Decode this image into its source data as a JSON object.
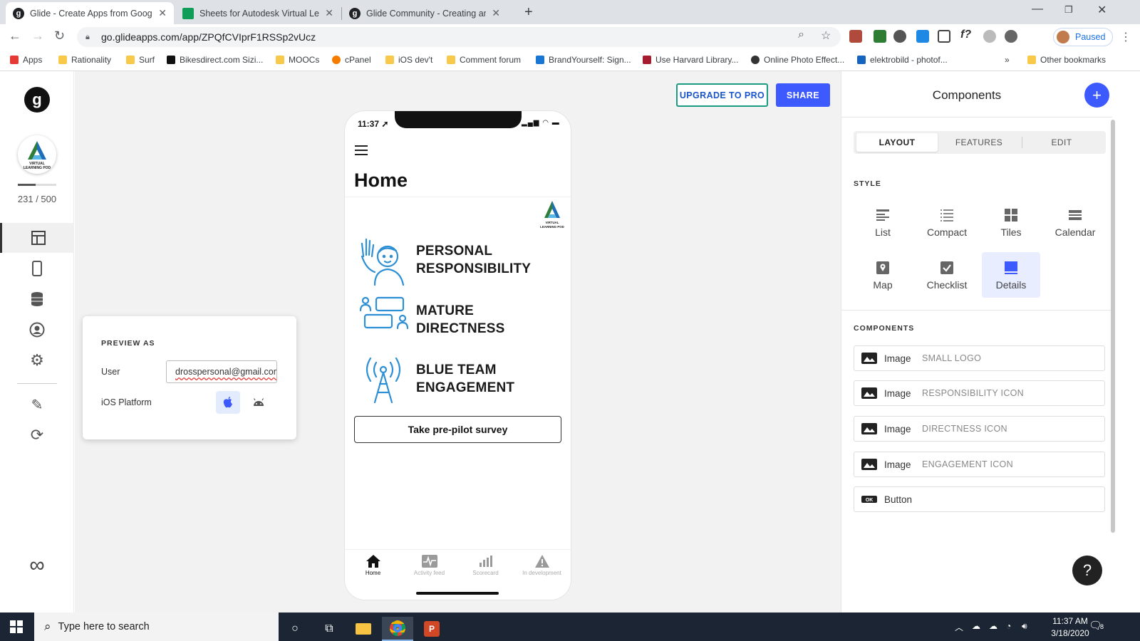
{
  "browser": {
    "tabs": [
      {
        "title": "Glide - Create Apps from Google",
        "favicon": "g"
      },
      {
        "title": "Sheets for Autodesk Virtual Learn",
        "favicon": "sheets"
      },
      {
        "title": "Glide Community - Creating ama",
        "favicon": "g"
      }
    ],
    "url": "go.glideapps.com/app/ZPQfCVIprF1RSSp2vUcz",
    "profile_status": "Paused",
    "bookmarks": [
      "Apps",
      "Rationality",
      "Surf",
      "Bikesdirect.com Sizi...",
      "MOOCs",
      "cPanel",
      "iOS dev't",
      "Comment forum",
      "BrandYourself: Sign...",
      "Use Harvard Library...",
      "Online Photo Effect...",
      "elektrobild - photof..."
    ],
    "bookmarks_overflow": "»",
    "other_bookmarks": "Other bookmarks"
  },
  "rail": {
    "logo_letter": "g",
    "app_icon_text": "VIRTUAL LEARNING POD",
    "rows_used": 231,
    "rows_max": 500,
    "rows_label": "231 / 500"
  },
  "header": {
    "upgrade_label": "UPGRADE TO PRO",
    "share_label": "SHARE"
  },
  "preview": {
    "heading": "PREVIEW AS",
    "user_label": "User",
    "user_value": "drosspersonal@gmail.com",
    "platform_label": "iOS Platform",
    "platform_selected": "ios"
  },
  "phone": {
    "time": "11:37",
    "title": "Home",
    "logo_text": "VIRTUAL LEARNING POD",
    "features": [
      {
        "line1": "PERSONAL",
        "line2": "RESPONSIBILITY",
        "icon": "waving-person-icon"
      },
      {
        "line1": "MATURE",
        "line2": "DIRECTNESS",
        "icon": "conversation-icon"
      },
      {
        "line1": "BLUE TEAM",
        "line2": "ENGAGEMENT",
        "icon": "antenna-tower-icon"
      }
    ],
    "survey_button": "Take pre-pilot survey",
    "tabs": [
      {
        "label": "Home",
        "icon": "home-icon",
        "active": true
      },
      {
        "label": "Activity feed",
        "icon": "activity-icon",
        "active": false
      },
      {
        "label": "Scorecard",
        "icon": "bar-chart-icon",
        "active": false
      },
      {
        "label": "In development",
        "icon": "warning-icon",
        "active": false
      }
    ]
  },
  "panel": {
    "title": "Components",
    "segments": [
      "LAYOUT",
      "FEATURES",
      "EDIT"
    ],
    "active_segment": "LAYOUT",
    "style_heading": "STYLE",
    "styles": [
      {
        "label": "List",
        "icon": "list-icon"
      },
      {
        "label": "Compact",
        "icon": "compact-icon"
      },
      {
        "label": "Tiles",
        "icon": "tiles-icon"
      },
      {
        "label": "Calendar",
        "icon": "calendar-icon"
      },
      {
        "label": "Map",
        "icon": "map-icon"
      },
      {
        "label": "Checklist",
        "icon": "checklist-icon"
      },
      {
        "label": "Details",
        "icon": "details-icon"
      }
    ],
    "selected_style": "Details",
    "components_heading": "COMPONENTS",
    "components": [
      {
        "type": "Image",
        "name": "SMALL LOGO"
      },
      {
        "type": "Image",
        "name": "RESPONSIBILITY ICON"
      },
      {
        "type": "Image",
        "name": "DIRECTNESS ICON"
      },
      {
        "type": "Image",
        "name": "ENGAGEMENT ICON"
      },
      {
        "type": "Button",
        "name": ""
      }
    ],
    "help_label": "?"
  },
  "taskbar": {
    "search_placeholder": "Type here to search",
    "time": "11:37 AM",
    "date": "3/18/2020",
    "notification_count": "8"
  },
  "colors": {
    "accent": "#3d5afe",
    "upgrade_border": "#1c9b83",
    "feature_icon_blue": "#2d8fd4",
    "selected_bg": "#e8edff"
  }
}
